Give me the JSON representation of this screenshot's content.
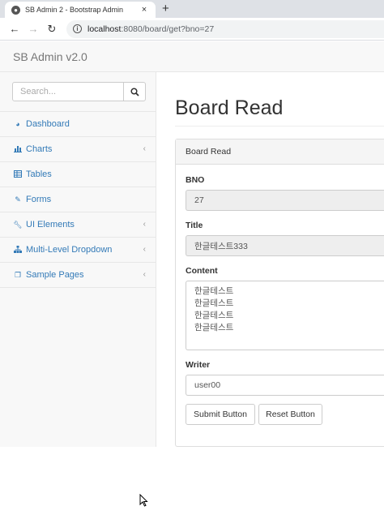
{
  "browser": {
    "tab_title": "SB Admin 2 - Bootstrap Admin",
    "tab_close": "×",
    "new_tab": "+",
    "url_host": "localhost",
    "url_rest": ":8080/board/get?bno=27"
  },
  "app": {
    "brand": "SB Admin v2.0"
  },
  "sidebar": {
    "search_placeholder": "Search...",
    "items": [
      {
        "label": "Dashboard",
        "icon": "dashboard-icon",
        "has_arrow": false
      },
      {
        "label": "Charts",
        "icon": "bar-chart-icon",
        "has_arrow": true
      },
      {
        "label": "Tables",
        "icon": "table-icon",
        "has_arrow": false
      },
      {
        "label": "Forms",
        "icon": "edit-icon",
        "has_arrow": false
      },
      {
        "label": "UI Elements",
        "icon": "wrench-icon",
        "has_arrow": true
      },
      {
        "label": "Multi-Level Dropdown",
        "icon": "sitemap-icon",
        "has_arrow": true
      },
      {
        "label": "Sample Pages",
        "icon": "files-icon",
        "has_arrow": true
      }
    ],
    "arrow": "‹"
  },
  "main": {
    "page_title": "Board Read",
    "panel_heading": "Board Read",
    "bno_label": "BNO",
    "bno_value": "27",
    "title_label": "Title",
    "title_value": "한글테스트333",
    "content_label": "Content",
    "content_lines": [
      "한글테스트",
      "한글테스트",
      "한글테스트",
      "한글테스트"
    ],
    "writer_label": "Writer",
    "writer_value": "user00",
    "submit_button": "Submit Button",
    "reset_button": "Reset Button"
  }
}
